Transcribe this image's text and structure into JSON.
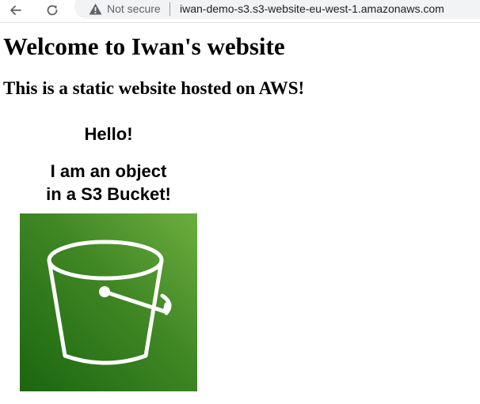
{
  "browser": {
    "security_label": "Not secure",
    "url": "iwan-demo-s3.s3-website-eu-west-1.amazonaws.com",
    "icons": {
      "back": "arrow-left-icon",
      "reload": "reload-icon",
      "security": "warning-triangle-icon"
    }
  },
  "page": {
    "heading": "Welcome to Iwan's website",
    "subheading": "This is a static website hosted on AWS!",
    "caption_line_1": "Hello!",
    "caption_line_2": "I am an object",
    "caption_line_3": "in a S3 Bucket!",
    "image": {
      "icon": "s3-bucket-icon",
      "gradient_dark": "#1b660f",
      "gradient_light": "#6cae3e"
    }
  }
}
